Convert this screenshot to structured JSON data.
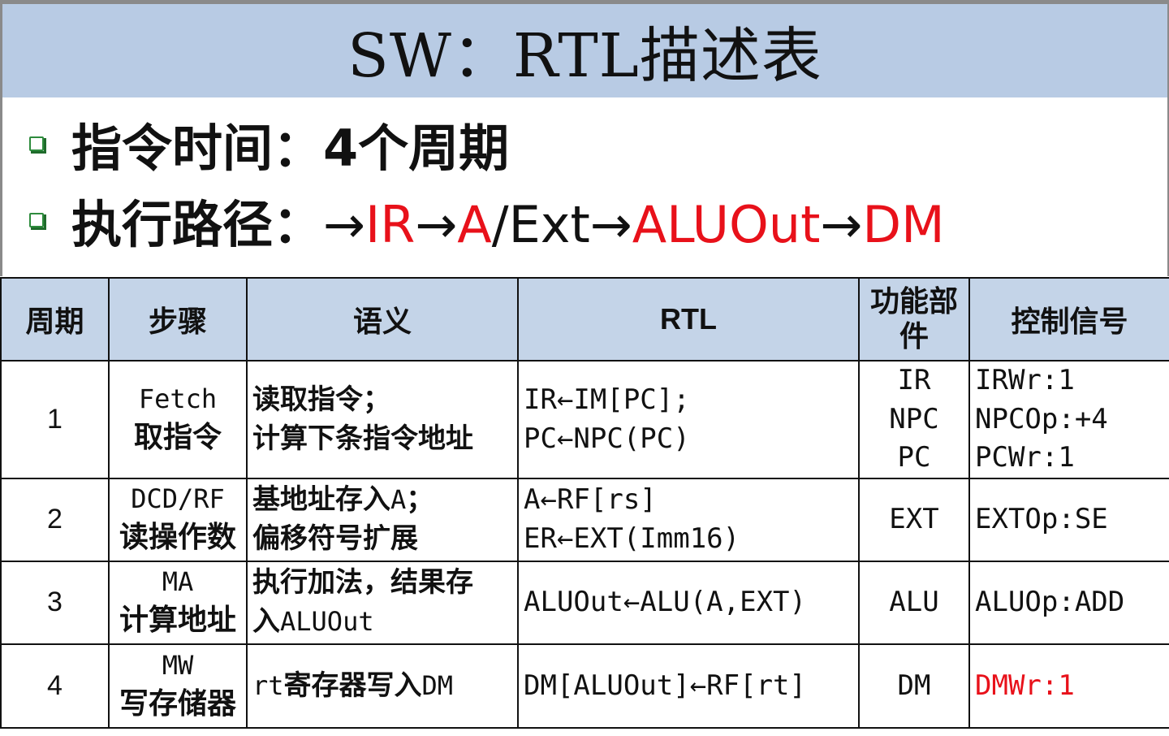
{
  "title": "SW：RTL描述表",
  "bullets": {
    "time": "指令时间：4个周期",
    "path_label": "执行路径：",
    "path": {
      "a1": "→",
      "ir": "IR",
      "a2": "→",
      "a": "A",
      "ext": "/Ext",
      "a3": "→",
      "aluout": "ALUOut",
      "a4": "→",
      "dm": "DM"
    }
  },
  "colors": {
    "title_bar": "#b8cbe4",
    "header_bg": "#c4d4e8",
    "accent_red": "#e8111a",
    "bullet_green": "#2e8b3d"
  },
  "table": {
    "headers": {
      "cycle": "周期",
      "step": "步骤",
      "semantics": "语义",
      "rtl": "RTL",
      "unit": "功能部件",
      "control": "控制信号"
    },
    "rows": [
      {
        "cycle": "1",
        "step_en": "Fetch",
        "step_zh": "取指令",
        "sem1": "读取指令；",
        "sem2": "计算下条指令地址",
        "rtl1": "IR←IM[PC];",
        "rtl2": "PC←NPC(PC)",
        "unit1": "IR",
        "unit2": "NPC",
        "unit3": "PC",
        "ctrl1": "IRWr:1",
        "ctrl2": "NPCOp:+4",
        "ctrl3": "PCWr:1"
      },
      {
        "cycle": "2",
        "step_en": "DCD/RF",
        "step_zh": "读操作数",
        "sem1_zh": "基地址存入",
        "sem1_en": "A",
        "sem1_end": "；",
        "sem2": "偏移符号扩展",
        "rtl1": "A←RF[rs]",
        "rtl2": "ER←EXT(Imm16)",
        "unit1": "EXT",
        "ctrl1": "EXTOp:SE"
      },
      {
        "cycle": "3",
        "step_en": "MA",
        "step_zh": "计算地址",
        "sem1": "执行加法，结果存",
        "sem2_zh": "入",
        "sem2_en": "ALUOut",
        "rtl1": "ALUOut←ALU(A,EXT)",
        "unit1": "ALU",
        "ctrl1": "ALUOp:ADD"
      },
      {
        "cycle": "4",
        "step_en": "MW",
        "step_zh": "写存储器",
        "sem1_en1": "rt",
        "sem1_zh": "寄存器写入",
        "sem1_en2": "DM",
        "rtl1": "DM[ALUOut]←RF[rt]",
        "unit1": "DM",
        "ctrl1": "DMWr:1"
      }
    ]
  }
}
